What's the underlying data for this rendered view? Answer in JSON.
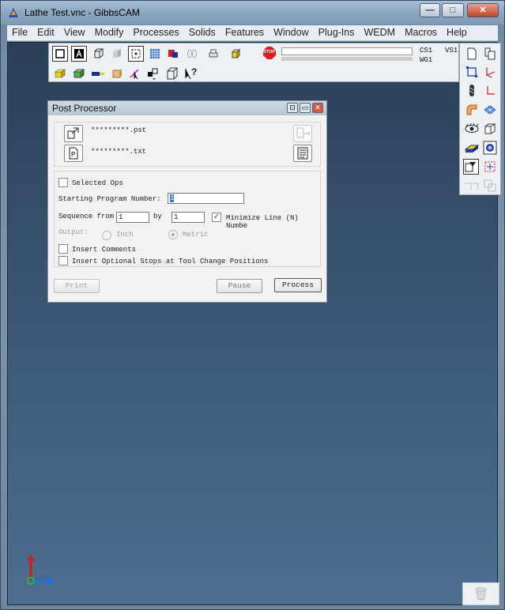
{
  "window": {
    "title": "Lathe Test.vnc - GibbsCAM",
    "minimize_label": "—",
    "maximize_label": "□",
    "close_label": "✕"
  },
  "menubar": {
    "items": [
      "File",
      "Edit",
      "View",
      "Modify",
      "Processes",
      "Solids",
      "Features",
      "Window",
      "Plug-Ins",
      "WEDM",
      "Macros",
      "Help"
    ]
  },
  "toolbar": {
    "stop_label": "STOP",
    "cs_label": "CS1",
    "vs_label": "VS1",
    "wg_label": "WG1"
  },
  "dialog": {
    "title": "Post Processor",
    "pst_file": "*********.pst",
    "txt_file": "*********.txt",
    "selected_ops_label": "Selected Ops",
    "selected_ops_checked": false,
    "starting_program_label": "Starting Program Number:",
    "starting_program_value": "1",
    "sequence_from_label": "Sequence from",
    "sequence_from_value": "1",
    "by_label": "by",
    "by_value": "1",
    "minimize_line_label": "Minimize Line (N) Numbe",
    "minimize_line_checked": true,
    "output_label": "Output:",
    "inch_label": "Inch",
    "metric_label": "Metric",
    "output_selected": "Metric",
    "insert_comments_label": "Insert Comments",
    "insert_comments_checked": false,
    "insert_stops_label": "Insert Optional Stops at Tool Change Positions",
    "insert_stops_checked": false,
    "print_label": "Print",
    "pause_label": "Pause",
    "process_label": "Process"
  },
  "colors": {
    "accent": "#3b77d0",
    "axis_x": "#1f6fe0",
    "axis_y": "#d11c1c",
    "axis_origin": "#2fb82f"
  }
}
